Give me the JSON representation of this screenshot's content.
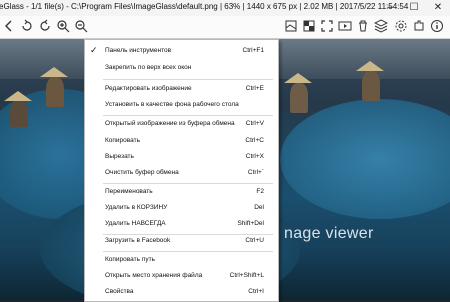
{
  "window": {
    "title": "eGlass - 1/1 file(s) - C:\\Program Files\\ImageGlass\\default.png  |  63%  |  1440 x 675 px  |  2.02 MB  |  2017/5/22 11:54:54",
    "minimize": "–",
    "maximize": "☐",
    "close": "✕"
  },
  "toolbar": {
    "icons": [
      "back-icon",
      "rotate-left-icon",
      "rotate-right-icon",
      "zoom-in-icon",
      "zoom-out-icon",
      "zoom-fit-icon",
      "actual-size-icon",
      "lock-zoom-icon",
      "fit-width-icon",
      "fit-height-icon",
      "scale-icon",
      "refresh-icon",
      "goto-icon",
      "thumbnail-icon",
      "checkerboard-icon",
      "fullscreen-icon",
      "slideshow-icon",
      "delete-icon",
      "extension-icon",
      "settings-icon",
      "about-icon"
    ]
  },
  "viewer": {
    "watermark": "nage viewer"
  },
  "menu": {
    "items": [
      {
        "label": "Панель инструментов",
        "shortcut": "Ctrl+F1",
        "checked": "✓"
      },
      {
        "label": "Закрепить по верх всех окон",
        "shortcut": ""
      },
      {
        "label": "Редактировать изображение",
        "shortcut": "Ctrl+E"
      },
      {
        "label": "Установить в качестве фона рабочего стола",
        "shortcut": ""
      },
      {
        "label": "Открытый изображение из буфера обмена",
        "shortcut": "Ctrl+V"
      },
      {
        "label": "Копировать",
        "shortcut": "Ctrl+C"
      },
      {
        "label": "Вырезать",
        "shortcut": "Ctrl+X"
      },
      {
        "label": "Очистить буфер обмена",
        "shortcut": "Ctrl+`"
      },
      {
        "label": "Переименовать",
        "shortcut": "F2"
      },
      {
        "label": "Удалить в КОРЗИНУ",
        "shortcut": "Del"
      },
      {
        "label": "Удалить НАВСЕГДА",
        "shortcut": "Shift+Del"
      },
      {
        "label": "Загрузить в Facebook",
        "shortcut": "Ctrl+U"
      },
      {
        "label": "Копировать путь",
        "shortcut": ""
      },
      {
        "label": "Открыть место хранения файла",
        "shortcut": "Ctrl+Shift+L"
      },
      {
        "label": "Свойства",
        "shortcut": "Ctrl+I"
      }
    ]
  }
}
